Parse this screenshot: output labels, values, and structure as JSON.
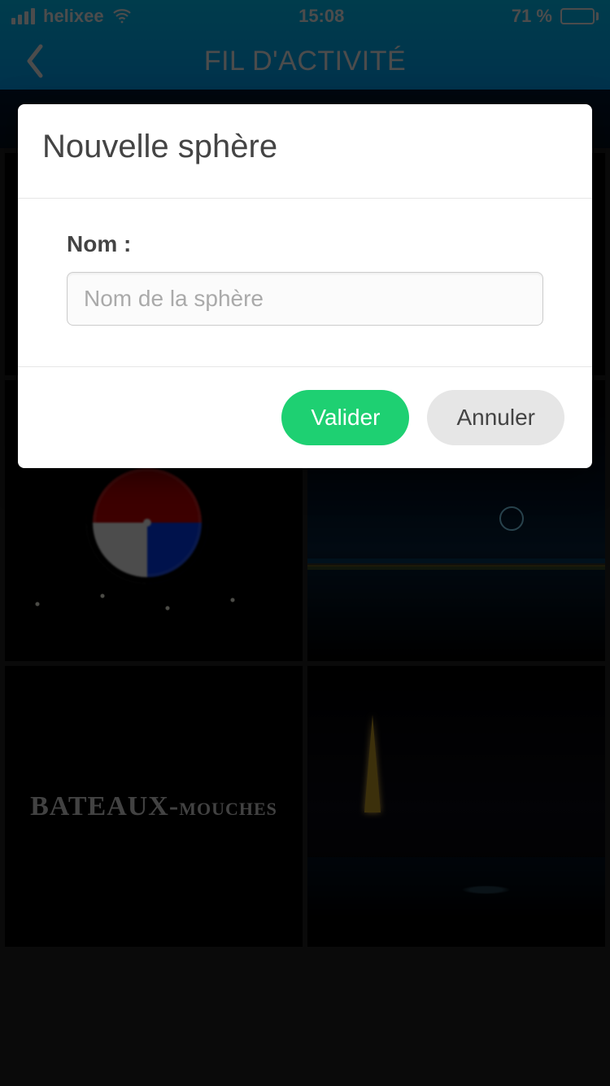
{
  "status": {
    "carrier": "helixee",
    "time": "15:08",
    "battery_pct": "71 %"
  },
  "nav": {
    "title": "FIL D'ACTIVITÉ"
  },
  "dialog": {
    "title": "Nouvelle sphère",
    "field_label": "Nom :",
    "placeholder": "Nom de la sphère",
    "confirm": "Valider",
    "cancel": "Annuler"
  },
  "bg": {
    "bateaux": "BATEAUX",
    "mouches": "MOUCHES"
  }
}
